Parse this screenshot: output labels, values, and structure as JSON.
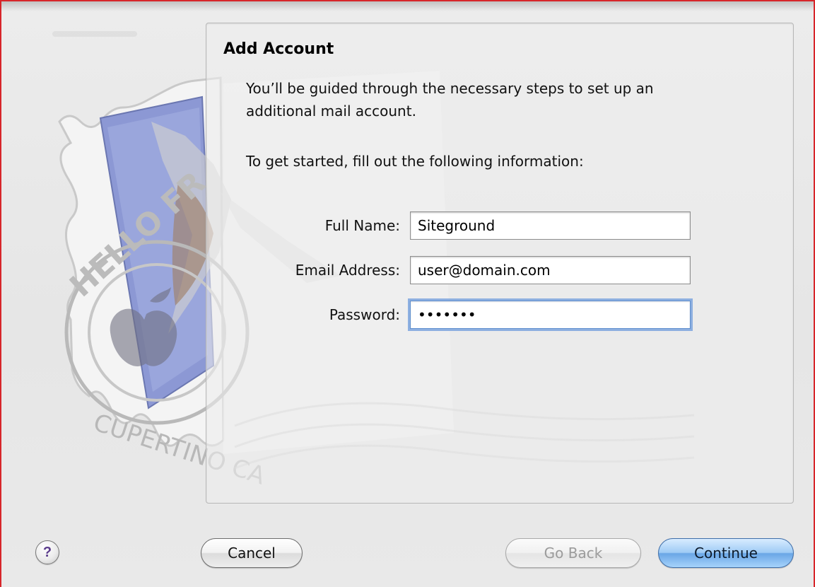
{
  "dialog": {
    "title": "Add Account",
    "intro": "You’ll be guided through the necessary steps to set up an additional mail account.",
    "prompt": "To get started, fill out the following information:"
  },
  "form": {
    "full_name_label": "Full Name:",
    "full_name_value": "Siteground",
    "email_label": "Email Address:",
    "email_value": "user@domain.com",
    "password_label": "Password:",
    "password_value": "•••••••"
  },
  "stamp": {
    "top_text": "HELLO FR",
    "bottom_text": "CUPERTINO CA"
  },
  "buttons": {
    "help": "?",
    "cancel": "Cancel",
    "go_back": "Go Back",
    "continue": "Continue"
  },
  "colors": {
    "window_border": "#d7252a",
    "default_button": "#6aa6e6",
    "focus_ring": "#6e9bdc"
  }
}
